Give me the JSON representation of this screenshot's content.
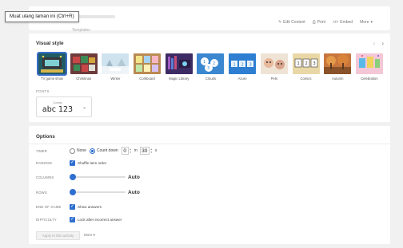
{
  "tooltip": "Muat ulang laman ini (Ctrl+R)",
  "header": {
    "subtitle": "Templates",
    "actions": [
      {
        "icon": "pencil-icon",
        "label": "Edit Content"
      },
      {
        "icon": "printer-icon",
        "label": "Print"
      },
      {
        "icon": "share-icon",
        "label": "Embed"
      },
      {
        "icon": "chevron-down-icon",
        "label": "More"
      }
    ]
  },
  "visual_style": {
    "title": "Visual style",
    "prev": "‹",
    "next": "›",
    "styles": [
      {
        "label": "TV game show",
        "selected": true
      },
      {
        "label": "Christmas",
        "selected": false
      },
      {
        "label": "Winter",
        "selected": false
      },
      {
        "label": "Corkboard",
        "selected": false
      },
      {
        "label": "Magic Library",
        "selected": false
      },
      {
        "label": "Clouds",
        "selected": false
      },
      {
        "label": "Azure",
        "selected": false
      },
      {
        "label": "Pets",
        "selected": false
      },
      {
        "label": "Comics",
        "selected": false
      },
      {
        "label": "Autumn",
        "selected": false
      },
      {
        "label": "Celebration",
        "selected": false
      }
    ],
    "fonts_label": "FONTS",
    "font": {
      "name": "Comic",
      "sample": "abc 123"
    }
  },
  "options": {
    "title": "Options",
    "timer": {
      "label": "TIMER",
      "none": "None",
      "countdown": "Count down",
      "minutes": "0",
      "min_unit": "m",
      "seconds": "30",
      "sec_unit": "s"
    },
    "random": {
      "label": "RANDOM",
      "text": "Shuffle item order",
      "checked": true
    },
    "columns": {
      "label": "COLUMNS",
      "value": "Auto",
      "level": 0
    },
    "rows": {
      "label": "ROWS",
      "value": "Auto",
      "level": 0
    },
    "end_of_game": {
      "label": "END OF GAME",
      "text": "Show answers",
      "checked": true
    },
    "difficulty": {
      "label": "DIFFICULTY",
      "text": "Lock after incorrect answer",
      "checked": true
    },
    "apply": "Apply to this activity",
    "more": "More"
  },
  "colors": {
    "accent": "#2f6fd0"
  }
}
